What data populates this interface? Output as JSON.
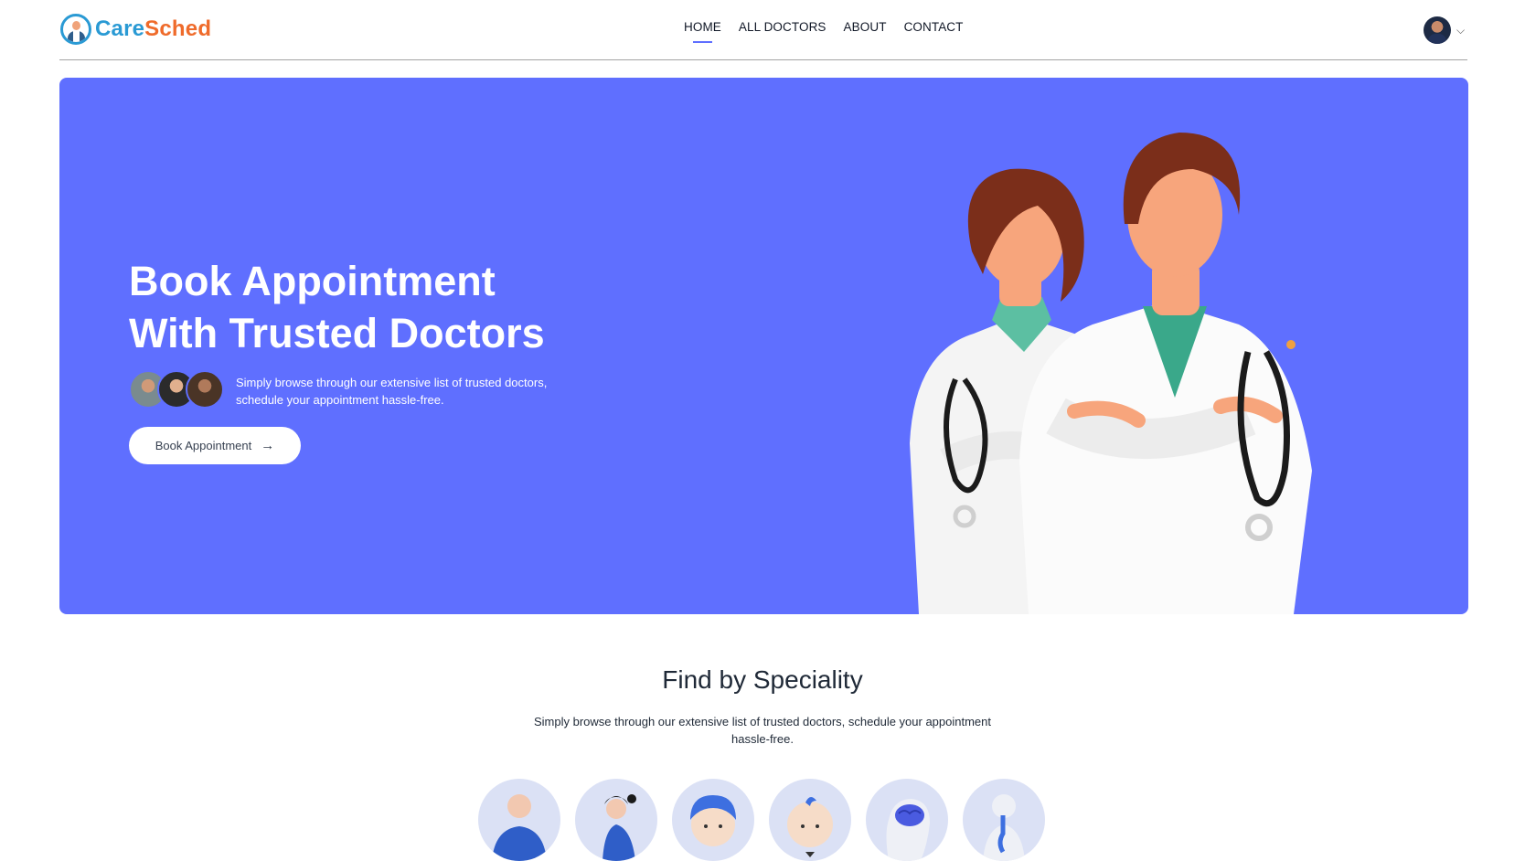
{
  "nav": {
    "logo": {
      "part1": "Care",
      "part2": "Sched"
    },
    "menu": [
      "HOME",
      "ALL DOCTORS",
      "ABOUT",
      "CONTACT"
    ],
    "active": "HOME",
    "chevron": "⌵"
  },
  "hero": {
    "title_line1": "Book Appointment",
    "title_line2": "With Trusted Doctors",
    "subtitle": "Simply browse through our extensive list of trusted doctors, schedule your appointment hassle-free.",
    "cta_label": "Book Appointment",
    "cta_arrow": "→"
  },
  "speciality": {
    "title": "Find by Speciality",
    "subtitle": "Simply browse through our extensive list of trusted doctors, schedule your appointment hassle-free.",
    "icons": [
      "general-physician-icon",
      "gynecologist-icon",
      "dermatologist-icon",
      "pediatrician-icon",
      "neurologist-icon",
      "gastroenterologist-icon"
    ]
  },
  "colors": {
    "primary": "#5f6fff",
    "brand_blue": "#2a9ad4",
    "brand_orange": "#ef6b2b"
  }
}
